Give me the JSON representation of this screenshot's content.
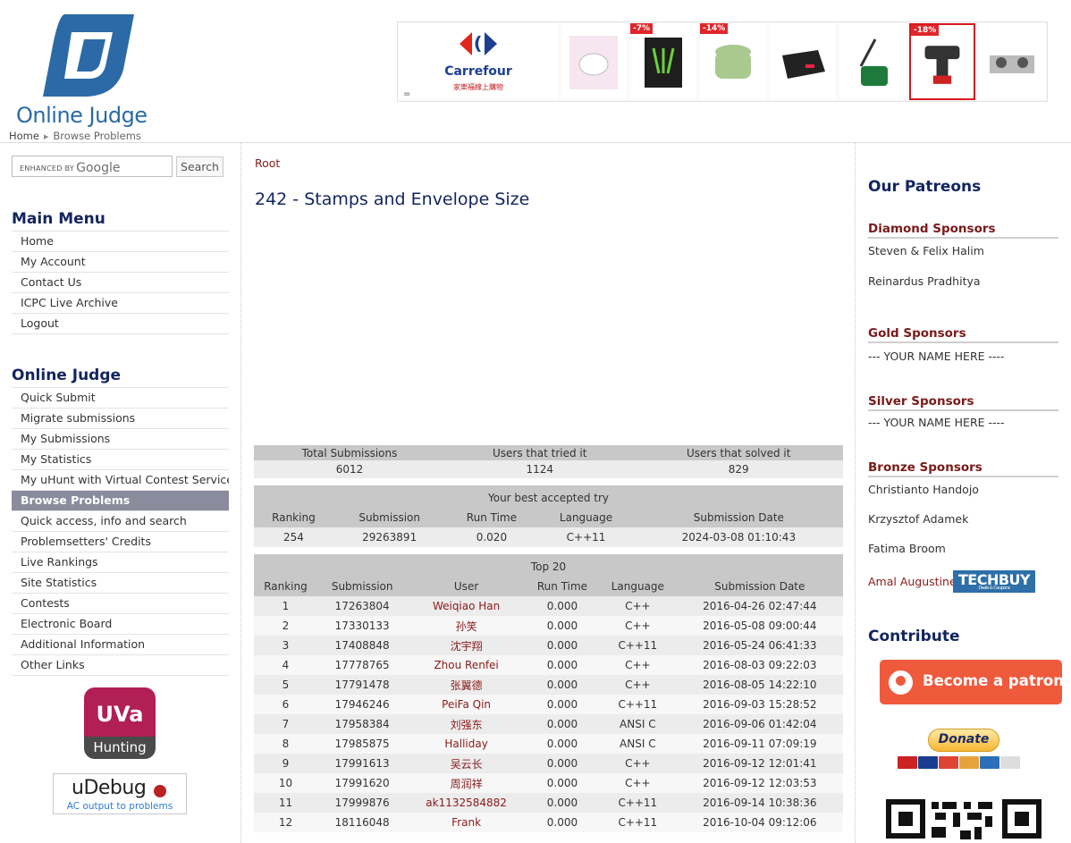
{
  "site": {
    "logo_text": "Online Judge"
  },
  "breadcrumb": {
    "home": "Home",
    "current": "Browse Problems"
  },
  "ad": {
    "brand_name": "Carrefour",
    "brand_tagline": "家樂福線上購物",
    "menu_icon": "=",
    "discounts": [
      "-7%",
      "-14%",
      "-18%"
    ]
  },
  "search": {
    "label": "ENHANCED BY",
    "provider": "Google",
    "button": "Search"
  },
  "main_menu": {
    "title": "Main Menu",
    "items": [
      "Home",
      "My Account",
      "Contact Us",
      "ICPC Live Archive",
      "Logout"
    ]
  },
  "oj_menu": {
    "title": "Online Judge",
    "items": [
      "Quick Submit",
      "Migrate submissions",
      "My Submissions",
      "My Statistics",
      "My uHunt with Virtual Contest Service",
      "Browse Problems",
      "Quick access, info and search",
      "Problemsetters' Credits",
      "Live Rankings",
      "Site Statistics",
      "Contests",
      "Electronic Board",
      "Additional Information",
      "Other Links"
    ],
    "active_index": 5
  },
  "uhunt": {
    "top": "UVa",
    "bottom": "Hunting"
  },
  "udebug": {
    "name": "uDebug",
    "tagline": "AC output to problems"
  },
  "main": {
    "root_link": "Root",
    "title": "242 - Stamps and Envelope Size",
    "stats": {
      "headers": [
        "Total Submissions",
        "Users that tried it",
        "Users that solved it"
      ],
      "values": [
        "6012",
        "1124",
        "829"
      ]
    },
    "best": {
      "caption": "Your best accepted try",
      "headers": [
        "Ranking",
        "Submission",
        "Run Time",
        "Language",
        "Submission Date"
      ],
      "row": [
        "254",
        "29263891",
        "0.020",
        "C++11",
        "2024-03-08 01:10:43"
      ]
    },
    "top20": {
      "caption": "Top 20",
      "headers": [
        "Ranking",
        "Submission",
        "User",
        "Run Time",
        "Language",
        "Submission Date"
      ],
      "rows": [
        [
          "1",
          "17263804",
          "Weiqiao Han",
          "0.000",
          "C++",
          "2016-04-26 02:47:44"
        ],
        [
          "2",
          "17330133",
          "孙笑",
          "0.000",
          "C++",
          "2016-05-08 09:00:44"
        ],
        [
          "3",
          "17408848",
          "沈宇翔",
          "0.000",
          "C++11",
          "2016-05-24 06:41:33"
        ],
        [
          "4",
          "17778765",
          "Zhou Renfei",
          "0.000",
          "C++",
          "2016-08-03 09:22:03"
        ],
        [
          "5",
          "17791478",
          "张翼德",
          "0.000",
          "C++",
          "2016-08-05 14:22:10"
        ],
        [
          "6",
          "17946246",
          "PeiFa Qin",
          "0.000",
          "C++11",
          "2016-09-03 15:28:52"
        ],
        [
          "7",
          "17958384",
          "刘强东",
          "0.000",
          "ANSI C",
          "2016-09-06 01:42:04"
        ],
        [
          "8",
          "17985875",
          "Halliday",
          "0.000",
          "ANSI C",
          "2016-09-11 07:09:19"
        ],
        [
          "9",
          "17991613",
          "吴云长",
          "0.000",
          "C++",
          "2016-09-12 12:01:41"
        ],
        [
          "10",
          "17991620",
          "周润祥",
          "0.000",
          "C++",
          "2016-09-12 12:03:53"
        ],
        [
          "11",
          "17999876",
          "ak1132584882",
          "0.000",
          "C++11",
          "2016-09-14 10:38:36"
        ],
        [
          "12",
          "18116048",
          "Frank",
          "0.000",
          "C++11",
          "2016-10-04 09:12:06"
        ]
      ]
    }
  },
  "right": {
    "patreons_title": "Our Patreons",
    "diamond": {
      "title": "Diamond Sponsors",
      "names": [
        "Steven & Felix Halim",
        "Reinardus Pradhitya"
      ]
    },
    "gold": {
      "title": "Gold Sponsors",
      "names": [
        "--- YOUR NAME HERE ----"
      ]
    },
    "silver": {
      "title": "Silver Sponsors",
      "names": [
        "--- YOUR NAME HERE ----"
      ]
    },
    "bronze": {
      "title": "Bronze Sponsors",
      "names": [
        "Christianto Handojo",
        "Krzysztof Adamek",
        "Fatima Broom",
        "Amal Augustine"
      ]
    },
    "techbuy": {
      "name": "TECHBUY",
      "sub": "Deals & Coupons"
    },
    "contribute_title": "Contribute",
    "patron_button": "Become a patron",
    "donate_button": "Donate"
  },
  "colors": {
    "heading": "#13255e",
    "link": "#8a1a1a",
    "patron": "#ef5a3c",
    "active_menu": "#8b8b9e"
  }
}
